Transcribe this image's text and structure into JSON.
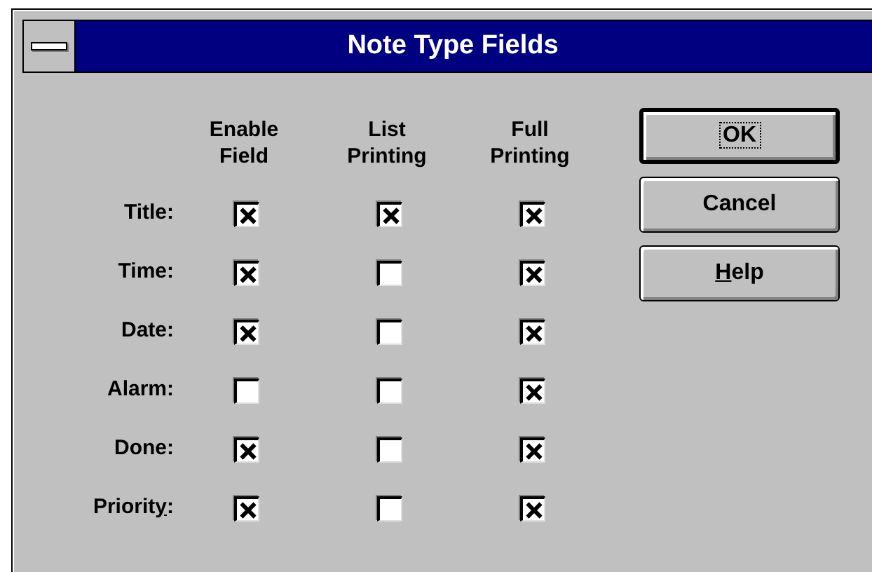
{
  "window": {
    "title": "Note Type Fields"
  },
  "columns": [
    "Enable\nField",
    "List\nPrinting",
    "Full\nPrinting"
  ],
  "rows": [
    {
      "label": "Title:",
      "checks": [
        true,
        true,
        true
      ]
    },
    {
      "label": "Time:",
      "checks": [
        true,
        false,
        true
      ]
    },
    {
      "label": "Date:",
      "checks": [
        true,
        false,
        true
      ]
    },
    {
      "label": "Alarm:",
      "checks": [
        false,
        false,
        true
      ]
    },
    {
      "label": "Done:",
      "checks": [
        true,
        false,
        true
      ]
    },
    {
      "label": "Priorit",
      "access_key": "y",
      "label_rest": ":",
      "checks": [
        true,
        false,
        true
      ]
    }
  ],
  "buttons": [
    {
      "label": "OK",
      "default": true,
      "focused": true
    },
    {
      "label": "Cancel",
      "default": false,
      "focused": false
    },
    {
      "access_key": "H",
      "label_rest": "elp",
      "default": false,
      "focused": false
    }
  ]
}
